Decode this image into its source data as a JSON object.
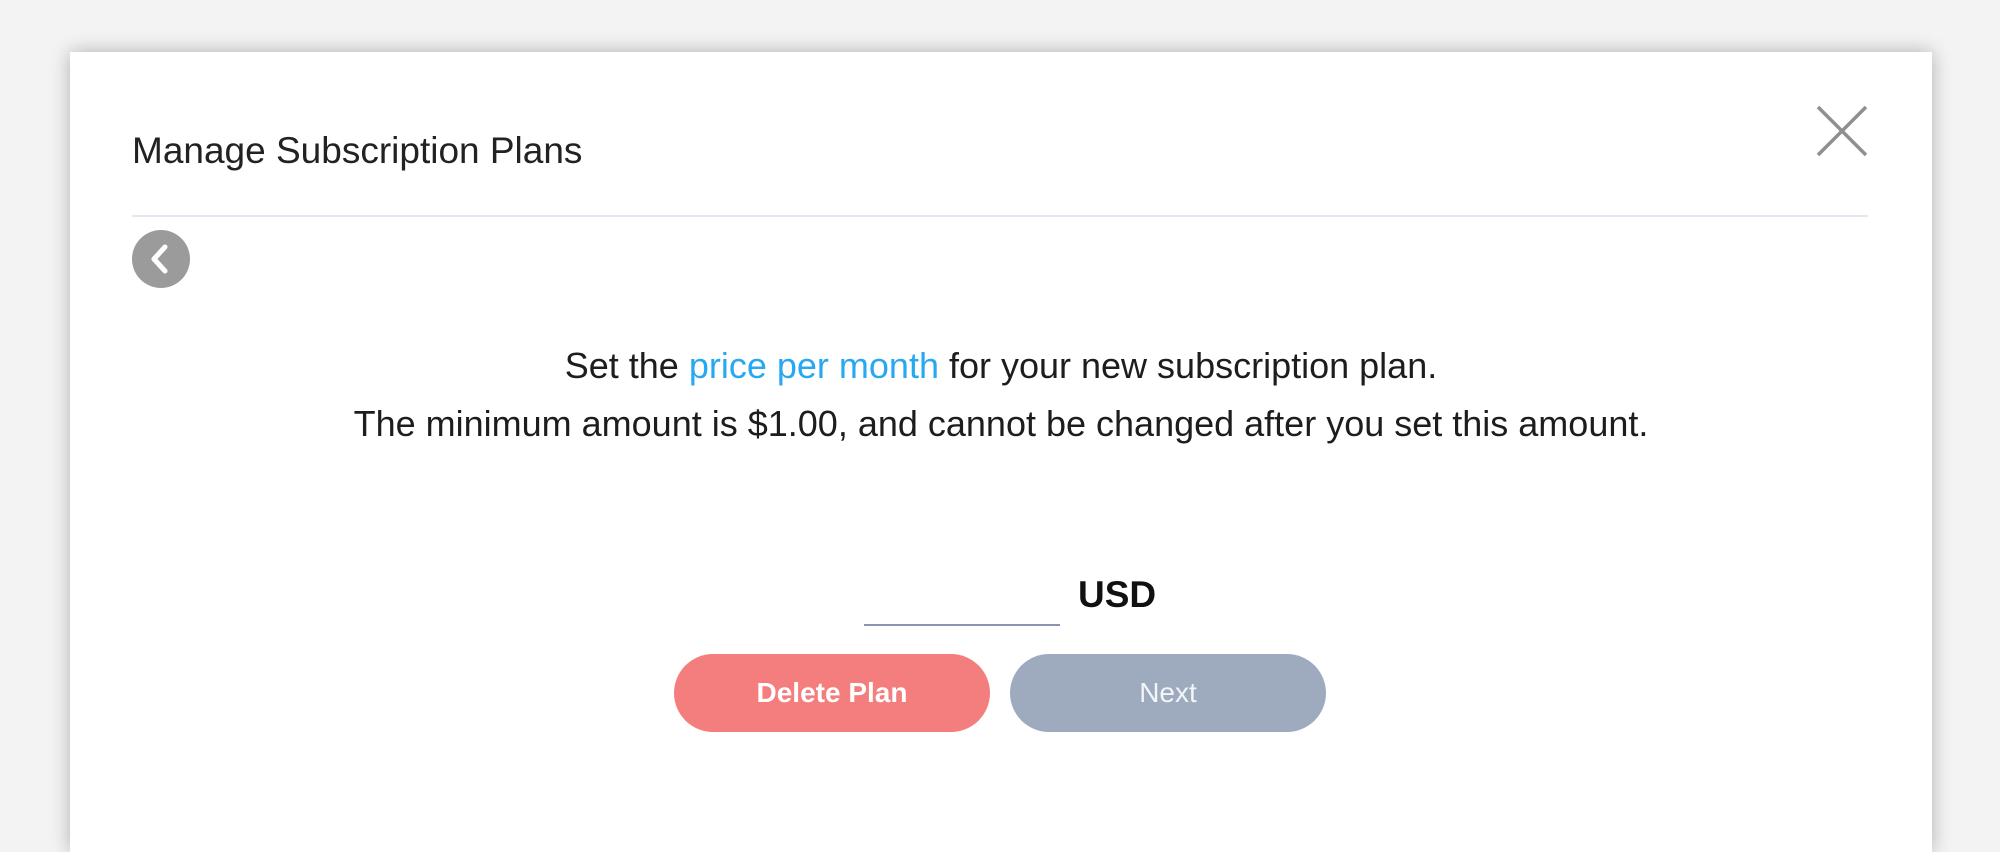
{
  "modal": {
    "title": "Manage Subscription Plans",
    "close_icon": "close-icon",
    "back_icon": "chevron-left-icon"
  },
  "message": {
    "line1_prefix": "Set the ",
    "line1_highlight": "price per month",
    "line1_suffix": " for your new subscription plan.",
    "line2": "The minimum amount is $1.00, and cannot be changed after you set this amount."
  },
  "price_field": {
    "value": "",
    "placeholder": "",
    "currency": "USD"
  },
  "buttons": {
    "delete_label": "Delete Plan",
    "next_label": "Next"
  },
  "colors": {
    "highlight": "#28a8f0",
    "delete_button": "#f47e7e",
    "next_button_disabled": "#9eabbf",
    "back_button": "#9b9b9b"
  }
}
